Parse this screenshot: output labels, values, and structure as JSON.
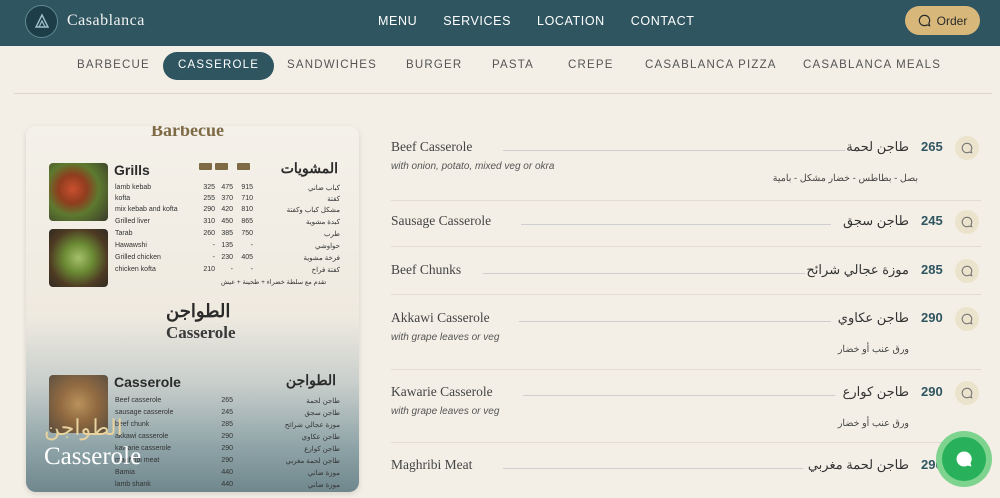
{
  "header": {
    "brand": "Casablanca",
    "nav": [
      "MENU",
      "SERVICES",
      "LOCATION",
      "CONTACT"
    ],
    "order_label": "Order"
  },
  "categories": {
    "items": [
      "BARBECUE",
      "CASSEROLE",
      "SANDWICHES",
      "BURGER",
      "PASTA",
      "CREPE",
      "CASABLANCA PIZZA",
      "CASABLANCA MEALS"
    ],
    "active": "CASSEROLE"
  },
  "menu_card": {
    "top_title": "Barbecue",
    "grills_en": "Grills",
    "grills_ar": "المشويات",
    "grills_rows": [
      {
        "en": "lamb kebab",
        "p1": "325",
        "p2": "475",
        "p3": "915",
        "ar": "كباب ضاني"
      },
      {
        "en": "kofta",
        "p1": "255",
        "p2": "370",
        "p3": "710",
        "ar": "كفتة"
      },
      {
        "en": "mix kebab and kofta",
        "p1": "290",
        "p2": "420",
        "p3": "810",
        "ar": "مشكل كباب وكفتة"
      },
      {
        "en": "Grilled liver",
        "p1": "310",
        "p2": "450",
        "p3": "865",
        "ar": "كبدة مشوية"
      },
      {
        "en": "Tarab",
        "p1": "260",
        "p2": "385",
        "p3": "750",
        "ar": "طرب"
      },
      {
        "en": "Hawawshi",
        "p1": "-",
        "p2": "135",
        "p3": "-",
        "ar": "حواوشي"
      },
      {
        "en": "Grilled chicken",
        "p1": "-",
        "p2": "230",
        "p3": "405",
        "ar": "فرخة مشوية"
      },
      {
        "en": "chicken kofta",
        "p1": "210",
        "p2": "-",
        "p3": "-",
        "ar": "كفتة فراخ"
      }
    ],
    "grills_note": "تقدم مع سلطة خضراء + طحينة + عيش",
    "casserole_ar": "الطواجن",
    "casserole_en": "Casserole",
    "cas_section_en": "Casserole",
    "cas_section_ar": "الطواجن",
    "cas_rows": [
      {
        "en": "Beef casserole",
        "p": "265",
        "ar": "طاجن لحمة"
      },
      {
        "en": "sausage casserole",
        "p": "245",
        "ar": "طاجن سجق"
      },
      {
        "en": "beef chunk",
        "p": "285",
        "ar": "موزة عجالي شرائح"
      },
      {
        "en": "akkawi casserole",
        "p": "290",
        "ar": "طاجن عكاوي"
      },
      {
        "en": "kawarie casserole",
        "p": "290",
        "ar": "طاجن كوارع"
      },
      {
        "en": "maghribi meat",
        "p": "290",
        "ar": "طاجن لحمة مغربي"
      },
      {
        "en": "Bamia",
        "p": "440",
        "ar": "موزة ضاني"
      },
      {
        "en": "lamb shank",
        "p": "440",
        "ar": "موزة ضاني"
      }
    ],
    "overlay_ar": "الطواجن",
    "overlay_en": "Casserole"
  },
  "items": [
    {
      "name": "Beef Casserole",
      "ar_name": "طاجن لحمة",
      "price": "265",
      "desc_en": "with onion, potato, mixed veg or okra",
      "desc_ar": "بصل - بطاطس - خضار مشكل - بامية"
    },
    {
      "name": "Sausage Casserole",
      "ar_name": "طاجن سجق",
      "price": "245",
      "desc_en": "",
      "desc_ar": ""
    },
    {
      "name": "Beef Chunks",
      "ar_name": "موزة عجالي شرائح",
      "price": "285",
      "desc_en": "",
      "desc_ar": ""
    },
    {
      "name": "Akkawi Casserole",
      "ar_name": "طاجن عكاوي",
      "price": "290",
      "desc_en": "with grape leaves or veg",
      "desc_ar": "ورق عنب أو خضار"
    },
    {
      "name": "Kawarie Casserole",
      "ar_name": "طاجن كوارع",
      "price": "290",
      "desc_en": "with grape leaves or veg",
      "desc_ar": "ورق عنب أو خضار"
    },
    {
      "name": "Maghribi Meat",
      "ar_name": "طاجن لحمة مغربي",
      "price": "290",
      "desc_en": "",
      "desc_ar": ""
    }
  ],
  "icons": {
    "chat": "chat-bubble-icon",
    "whatsapp": "whatsapp-icon",
    "logo": "logo-icon"
  },
  "colors": {
    "primary": "#2f5560",
    "accent": "#d8b77a",
    "background": "#f3efe6",
    "whatsapp": "#28b05a"
  }
}
